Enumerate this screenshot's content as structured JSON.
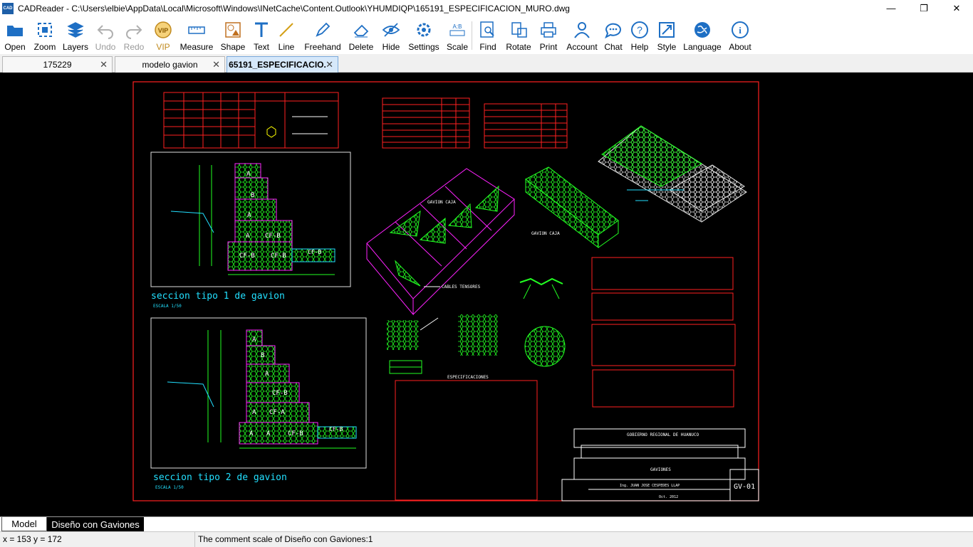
{
  "window": {
    "title": "CADReader - C:\\Users\\elbie\\AppData\\Local\\Microsoft\\Windows\\INetCache\\Content.Outlook\\YHUMDIQP\\165191_ESPECIFICACION_MURO.dwg",
    "app_icon_text": "CAD",
    "minimize": "—",
    "maximize": "❐",
    "close": "✕"
  },
  "toolbar": [
    {
      "id": "open",
      "label": "Open",
      "icon": "folder-icon"
    },
    {
      "id": "zoom",
      "label": "Zoom",
      "icon": "zoom-icon"
    },
    {
      "id": "layers",
      "label": "Layers",
      "icon": "layers-icon"
    },
    {
      "id": "undo",
      "label": "Undo",
      "icon": "undo-icon",
      "disabled": true
    },
    {
      "id": "redo",
      "label": "Redo",
      "icon": "redo-icon",
      "disabled": true
    },
    {
      "id": "vip",
      "label": "VIP",
      "icon": "vip-icon",
      "badge": "VIP"
    },
    {
      "id": "measure",
      "label": "Measure",
      "icon": "ruler-icon"
    },
    {
      "id": "shape",
      "label": "Shape",
      "icon": "shape-icon"
    },
    {
      "id": "text",
      "label": "Text",
      "icon": "text-icon"
    },
    {
      "id": "line",
      "label": "Line",
      "icon": "line-icon"
    },
    {
      "id": "freehand",
      "label": "Freehand",
      "icon": "pen-icon"
    },
    {
      "id": "delete",
      "label": "Delete",
      "icon": "eraser-icon"
    },
    {
      "id": "hide",
      "label": "Hide",
      "icon": "eye-slash-icon"
    },
    {
      "id": "settings",
      "label": "Settings",
      "icon": "settings-icon"
    },
    {
      "id": "scale",
      "label": "Scale",
      "icon": "scale-icon",
      "badge": "A:B"
    },
    {
      "id": "find",
      "label": "Find",
      "icon": "find-icon"
    },
    {
      "id": "rotate",
      "label": "Rotate",
      "icon": "rotate-icon"
    },
    {
      "id": "print",
      "label": "Print",
      "icon": "printer-icon"
    },
    {
      "id": "account",
      "label": "Account",
      "icon": "user-icon"
    },
    {
      "id": "chat",
      "label": "Chat",
      "icon": "chat-icon"
    },
    {
      "id": "help",
      "label": "Help",
      "icon": "help-icon"
    },
    {
      "id": "style",
      "label": "Style",
      "icon": "style-icon"
    },
    {
      "id": "language",
      "label": "Language",
      "icon": "globe-icon"
    },
    {
      "id": "about",
      "label": "About",
      "icon": "info-icon"
    }
  ],
  "doc_tabs": [
    {
      "label": "175229",
      "active": false
    },
    {
      "label": "modelo gavion",
      "active": false
    },
    {
      "label": "65191_ESPECIFICACIO.",
      "active": true
    }
  ],
  "tab_close_glyph": "✕",
  "drawing": {
    "section1_title": "seccion tipo 1 de gavion",
    "section2_title": "seccion tipo 2 de gavion",
    "scale_note": "ESCALA 1/50",
    "gavion_caja": "GAVION CAJA",
    "cables_tensores": "CABLES TENSORES",
    "especificaciones": "ESPECIFICACIONES",
    "title_block": {
      "org": "GOBIERNO REGIONAL DE HUANUCO",
      "sheet_name": "GAVIONES",
      "engineer": "Ing. JUAN JOSE CESPEDES LLAP",
      "date": "Oct. 2012",
      "sheet_code": "GV-01"
    },
    "block_letters": [
      "A",
      "B",
      "A",
      "A",
      "CF-B",
      "CF-B",
      "CF-B",
      "CF-B"
    ],
    "block_letters2": [
      "A",
      "B",
      "A",
      "A",
      "CF-B",
      "CF-A",
      "A",
      "A",
      "CF-B",
      "CF-B"
    ]
  },
  "layout_tabs": [
    {
      "label": "Model",
      "active": true
    },
    {
      "label": "Diseño con Gaviones",
      "active": false
    }
  ],
  "status": {
    "coords": "x = 153 y = 172",
    "message": "The comment scale of Diseño con Gaviones:1"
  },
  "colors": {
    "accent": "#1e6fc4",
    "frame_red": "#ff2020",
    "cad_green": "#22ff22",
    "cad_magenta": "#ff22ff",
    "cad_cyan": "#22e0ff",
    "vip_gold": "#c08a1e"
  }
}
